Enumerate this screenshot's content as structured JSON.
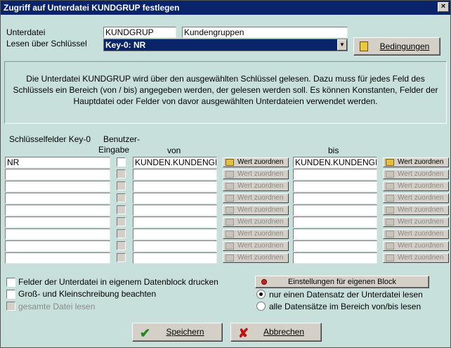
{
  "title": "Zugriff auf Unterdatei KUNDGRUP festlegen",
  "close_glyph": "×",
  "unterdatei_label": "Unterdatei",
  "unterdatei_value": "KUNDGRUP",
  "unterdatei_desc": "Kundengruppen",
  "key_label": "Lesen über Schlüssel",
  "key_value": "Key-0: NR",
  "conditions_button": "Bedingungen",
  "info_text": "Die Unterdatei KUNDGRUP wird über den ausgewählten Schlüssel gelesen. Dazu muss für jedes Feld des Schlüssels ein Bereich (von / bis) angegeben werden, der gelesen werden soll. Es können Konstanten, Felder der Hauptdatei oder Felder von davor ausgewählten Unterdateien verwendet werden.",
  "col_keyfields": "Schlüsselfelder Key-0",
  "col_user_input_1": "Benutzer-",
  "col_user_input_2": "Eingabe",
  "col_von": "von",
  "col_bis": "bis",
  "assign_label": "Wert zuordnen",
  "rows": [
    {
      "key": "NR",
      "von": "KUNDEN.KUNDENGI",
      "bis": "KUNDEN.KUNDENGI"
    },
    {
      "key": "",
      "von": "",
      "bis": ""
    },
    {
      "key": "",
      "von": "",
      "bis": ""
    },
    {
      "key": "",
      "von": "",
      "bis": ""
    },
    {
      "key": "",
      "von": "",
      "bis": ""
    },
    {
      "key": "",
      "von": "",
      "bis": ""
    },
    {
      "key": "",
      "von": "",
      "bis": ""
    },
    {
      "key": "",
      "von": "",
      "bis": ""
    },
    {
      "key": "",
      "von": "",
      "bis": ""
    }
  ],
  "opt_print_block": "Felder der Unterdatei in eigenem Datenblock drucken",
  "opt_case": "Groß- und Kleinschreibung beachten",
  "opt_read_all": "gesamte Datei lesen",
  "block_settings_button": "Einstellungen für eigenen Block",
  "radio_one": "nur einen Datensatz der Unterdatei lesen",
  "radio_all": "alle Datensätze im Bereich von/bis lesen",
  "save_button": "Speichern",
  "cancel_button": "Abbrechen"
}
